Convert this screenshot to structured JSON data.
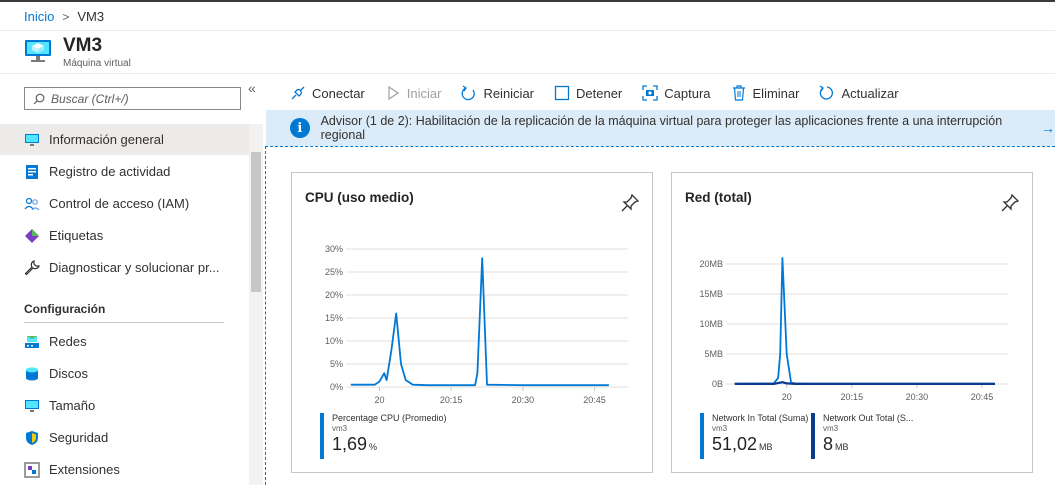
{
  "breadcrumb": {
    "home": "Inicio",
    "separator": ">",
    "current": "VM3"
  },
  "header": {
    "title": "VM3",
    "subtitle": "Máquina virtual"
  },
  "sidebar": {
    "search_placeholder": "Buscar (Ctrl+/)",
    "collapse": "«",
    "items": [
      {
        "label": "Información general",
        "icon": "monitor-icon"
      },
      {
        "label": "Registro de actividad",
        "icon": "activity-log-icon"
      },
      {
        "label": "Control de acceso (IAM)",
        "icon": "people-icon"
      },
      {
        "label": "Etiquetas",
        "icon": "tag-icon"
      },
      {
        "label": "Diagnosticar y solucionar pr...",
        "icon": "wrench-icon"
      }
    ],
    "section": "Configuración",
    "config_items": [
      {
        "label": "Redes",
        "icon": "network-icon"
      },
      {
        "label": "Discos",
        "icon": "disks-icon"
      },
      {
        "label": "Tamaño",
        "icon": "size-icon"
      },
      {
        "label": "Seguridad",
        "icon": "shield-icon"
      },
      {
        "label": "Extensiones",
        "icon": "extensions-icon"
      }
    ]
  },
  "toolbar": {
    "connect": "Conectar",
    "start": "Iniciar",
    "restart": "Reiniciar",
    "stop": "Detener",
    "capture": "Captura",
    "delete": "Eliminar",
    "refresh": "Actualizar"
  },
  "banner": {
    "text": "Advisor (1 de 2): Habilitación de la replicación de la máquina virtual para proteger las aplicaciones frente a una interrupción regional",
    "arrow": "→",
    "info": "i"
  },
  "cards": {
    "cpu": {
      "title": "CPU (uso medio)",
      "legend_name": "Percentage CPU (Promedio)",
      "legend_sub": "vm3",
      "legend_value": "1,69",
      "legend_unit": "%"
    },
    "net": {
      "title": "Red (total)",
      "legend1_name": "Network In Total (Suma)",
      "legend1_sub": "vm3",
      "legend1_value": "51,02",
      "legend1_unit": "MB",
      "legend2_name": "Network Out Total (S...",
      "legend2_sub": "vm3",
      "legend2_value": "8",
      "legend2_unit": "MB"
    }
  },
  "chart_data": [
    {
      "type": "line",
      "title": "CPU (uso medio)",
      "y_ticks": [
        "0%",
        "5%",
        "10%",
        "15%",
        "20%",
        "25%",
        "30%"
      ],
      "ylim": [
        0,
        30
      ],
      "x_ticks": [
        "20",
        "20:15",
        "20:30",
        "20:45"
      ],
      "x_tick_minutes": [
        0,
        15,
        30,
        45
      ],
      "xlim": [
        -7,
        52
      ],
      "series": [
        {
          "name": "Percentage CPU (Promedio)",
          "color": "#0078d4",
          "x": [
            -6,
            -1,
            0,
            1,
            1.5,
            2.5,
            3.5,
            4.5,
            5.5,
            7,
            10,
            15,
            20,
            20.5,
            21.5,
            22.5,
            30,
            40,
            48
          ],
          "y": [
            0.5,
            0.5,
            1.2,
            3,
            1.5,
            8,
            16,
            5,
            1.5,
            0.5,
            0.4,
            0.4,
            0.4,
            3,
            28,
            0.5,
            0.4,
            0.4,
            0.4
          ]
        }
      ]
    },
    {
      "type": "line",
      "title": "Red (total)",
      "y_ticks": [
        "0B",
        "5MB",
        "10MB",
        "15MB",
        "20MB"
      ],
      "ylim": [
        0,
        20
      ],
      "x_ticks": [
        "20",
        "20:15",
        "20:30",
        "20:45"
      ],
      "x_tick_minutes": [
        0,
        15,
        30,
        45
      ],
      "xlim": [
        -14,
        51
      ],
      "series": [
        {
          "name": "Network In Total (Suma)",
          "color": "#0078d4",
          "x": [
            -12,
            -3,
            -2,
            -1.5,
            -1,
            0,
            1,
            2,
            5,
            15,
            30,
            48
          ],
          "y": [
            0.05,
            0.1,
            1,
            5,
            21,
            5,
            0.2,
            0.1,
            0.05,
            0.05,
            0.05,
            0.05
          ]
        },
        {
          "name": "Network Out Total (S...",
          "color": "#0b3a8f",
          "x": [
            -12,
            -3,
            -1,
            0,
            2,
            15,
            30,
            48
          ],
          "y": [
            0.02,
            0.02,
            0.3,
            0.1,
            0.02,
            0.02,
            0.02,
            0.02
          ]
        }
      ]
    }
  ]
}
